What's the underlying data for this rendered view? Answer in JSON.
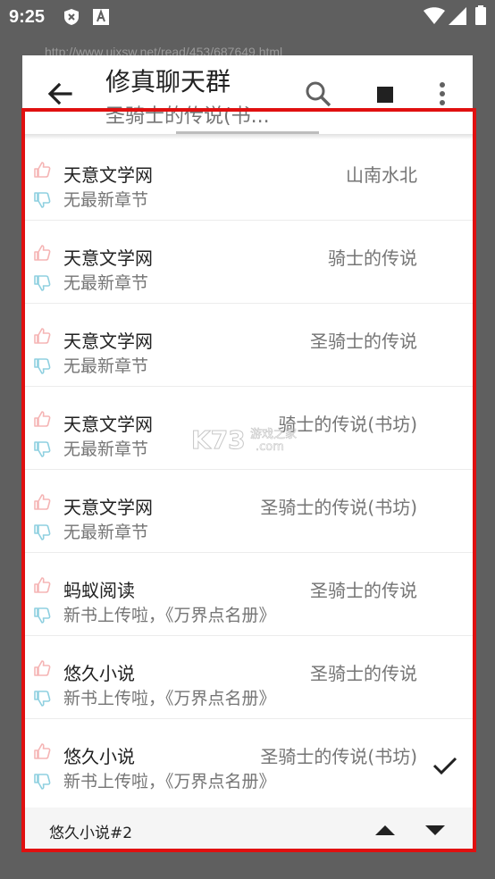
{
  "status_bar": {
    "time": "9:25"
  },
  "background": {
    "url": "http://www.uixsw.net/read/453/687649.html"
  },
  "toolbar": {
    "title": "修真聊天群",
    "subtitle": "圣骑士的传说(书..."
  },
  "sources": [
    {
      "name": "天意文学网",
      "latest": "无最新章节",
      "book": "山南水北",
      "selected": false
    },
    {
      "name": "天意文学网",
      "latest": "无最新章节",
      "book": "骑士的传说",
      "selected": false
    },
    {
      "name": "天意文学网",
      "latest": "无最新章节",
      "book": "圣骑士的传说",
      "selected": false
    },
    {
      "name": "天意文学网",
      "latest": "无最新章节",
      "book": "骑士的传说(书坊)",
      "selected": false
    },
    {
      "name": "天意文学网",
      "latest": "无最新章节",
      "book": "圣骑士的传说(书坊)",
      "selected": false
    },
    {
      "name": "蚂蚁阅读",
      "latest": "新书上传啦，《万界点名册》",
      "book": "圣骑士的传说",
      "selected": false
    },
    {
      "name": "悠久小说",
      "latest": "新书上传啦，《万界点名册》",
      "book": "圣骑士的传说",
      "selected": false
    },
    {
      "name": "悠久小说",
      "latest": "新书上传啦，《万界点名册》",
      "book": "圣骑士的传说(书坊)",
      "selected": true
    }
  ],
  "bottom_bar": {
    "label": "悠久小说#2"
  },
  "watermark": {
    "text": "K73",
    "sub": "游戏之家",
    "domain": ".com"
  },
  "colors": {
    "thumb_up": "#f5b5b5",
    "thumb_down": "#8fd0e0",
    "highlight": "#e01010"
  }
}
